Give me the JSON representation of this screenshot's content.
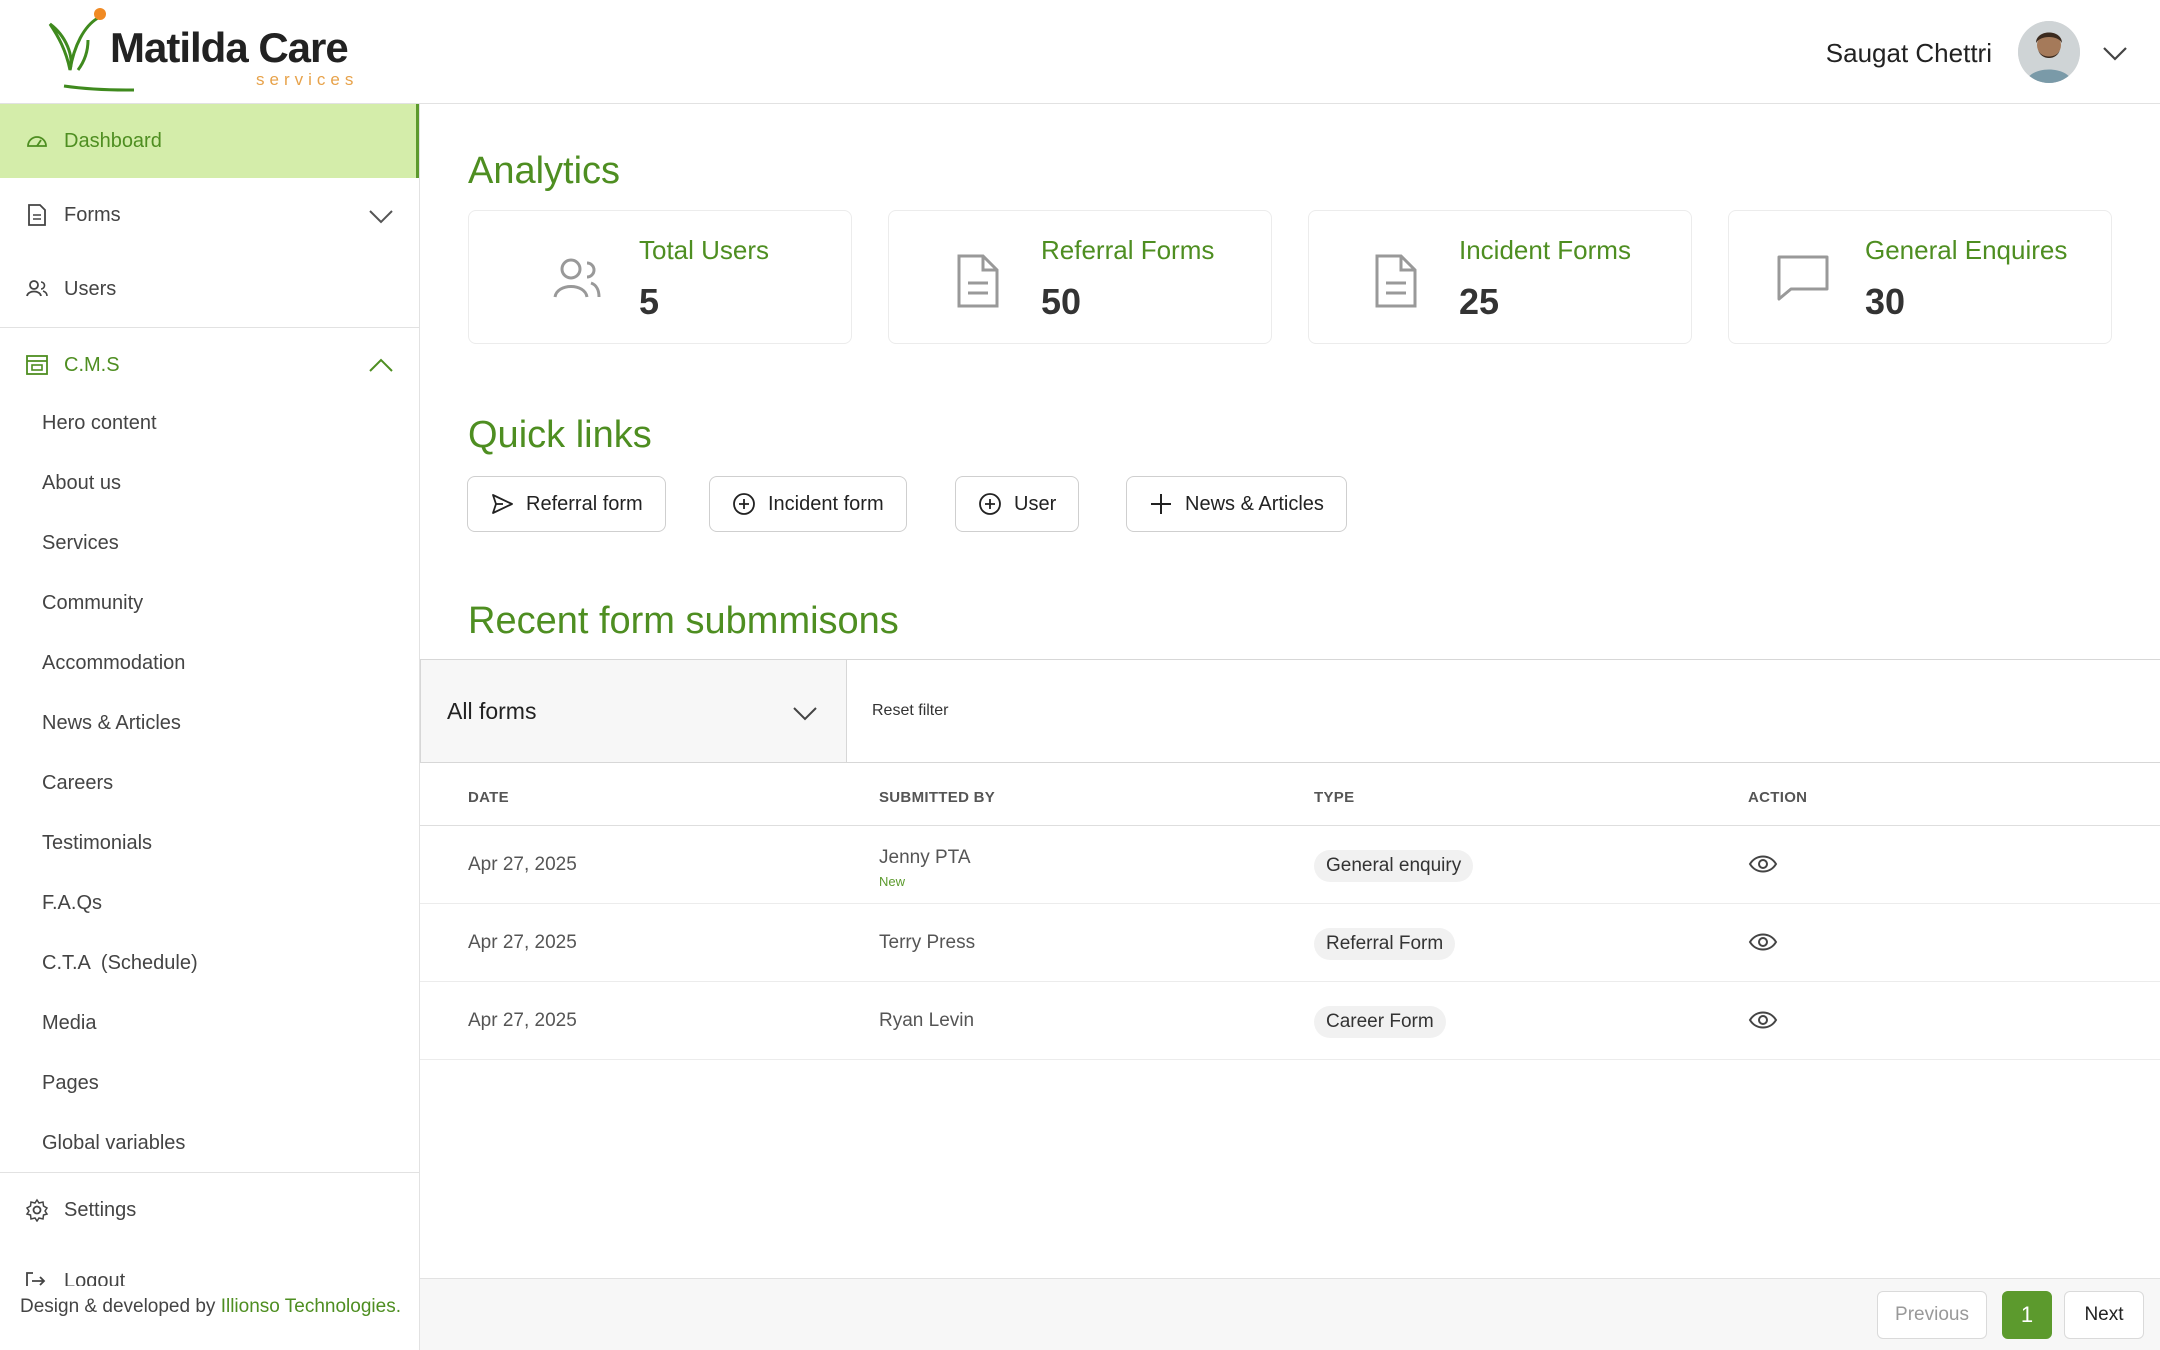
{
  "brand": {
    "name": "Matilda Care",
    "tagline": "services",
    "primary_color": "#4e8e21",
    "accent_color": "#d4edaa",
    "logo_icon": "butterfly-icon"
  },
  "header": {
    "user_name": "Saugat Chettri",
    "avatar_icon": "avatar"
  },
  "sidebar": {
    "items": [
      {
        "label": "Dashboard",
        "icon": "dashboard-icon",
        "active": true
      },
      {
        "label": "Forms",
        "icon": "document-icon",
        "expanded": false
      },
      {
        "label": "Users",
        "icon": "users-icon"
      },
      {
        "label": "C.M.S",
        "icon": "cms-icon",
        "expanded": true
      }
    ],
    "cms_items": [
      "Hero content",
      "About us",
      "Services",
      "Community",
      "Accommodation",
      "News & Articles",
      "Careers",
      "Testimonials",
      "F.A.Qs",
      "C.T.A  (Schedule)",
      "Media",
      "Pages",
      "Global variables"
    ],
    "settings_label": "Settings",
    "logout_label": "Logout",
    "credit_prefix": "Design & developed by",
    "credit_brand": "Illionso Technologies."
  },
  "analytics": {
    "title": "Analytics",
    "cards": [
      {
        "label": "Total Users",
        "value": "5",
        "icon": "users-icon"
      },
      {
        "label": "Referral Forms",
        "value": "50",
        "icon": "document-icon"
      },
      {
        "label": "Incident Forms",
        "value": "25",
        "icon": "document-icon"
      },
      {
        "label": "General Enquires",
        "value": "30",
        "icon": "chat-icon"
      }
    ]
  },
  "quick_links": {
    "title": "Quick links",
    "buttons": [
      {
        "label": "Referral form",
        "icon": "send-icon"
      },
      {
        "label": "Incident form",
        "icon": "plus-circle-icon"
      },
      {
        "label": "User",
        "icon": "plus-circle-icon"
      },
      {
        "label": "News & Articles",
        "icon": "plus-icon"
      }
    ]
  },
  "recent": {
    "title": "Recent form submmisons",
    "filter": {
      "selected": "All forms",
      "reset_label": "Reset filter"
    },
    "columns": [
      "DATE",
      "SUBMITTED BY",
      "TYPE",
      "ACTION"
    ],
    "rows": [
      {
        "date": "Apr 27, 2025",
        "submitted_by": "Jenny PTA",
        "badge": "New",
        "type": "General enquiry"
      },
      {
        "date": "Apr 27, 2025",
        "submitted_by": "Terry Press",
        "badge": "",
        "type": "Referral Form"
      },
      {
        "date": "Apr 27, 2025",
        "submitted_by": "Ryan Levin",
        "badge": "",
        "type": "Career Form"
      }
    ]
  },
  "pagination": {
    "previous_label": "Previous",
    "current_page": "1",
    "next_label": "Next"
  }
}
